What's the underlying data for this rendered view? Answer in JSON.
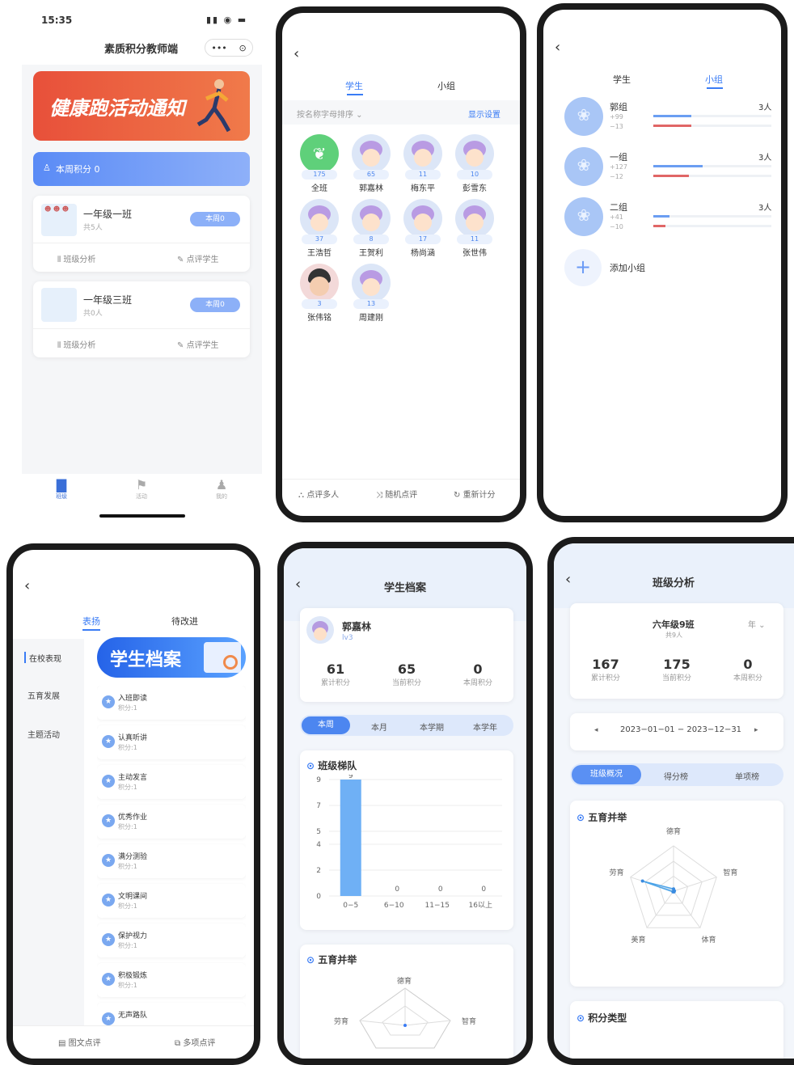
{
  "p1": {
    "time": "15:35",
    "title": "素质积分教师端",
    "banner": "健康跑活动通知",
    "weekly_score": "本周积分  0",
    "classes": [
      {
        "name": "一年级一班",
        "meta": "共5人",
        "badge": "本周0"
      },
      {
        "name": "一年级三班",
        "meta": "共0人",
        "badge": "本周0"
      }
    ],
    "analysis": "班级分析",
    "comment": "点评学生",
    "tabs": [
      "班级",
      "活动",
      "我的"
    ]
  },
  "p2": {
    "tabs": [
      "学生",
      "小组"
    ],
    "sort": "按名称字母排序",
    "settings": "显示设置",
    "students": [
      {
        "score": "175",
        "name": "全班"
      },
      {
        "score": "65",
        "name": "郭嘉林"
      },
      {
        "score": "11",
        "name": "梅东平"
      },
      {
        "score": "10",
        "name": "彭雪东"
      },
      {
        "score": "37",
        "name": "王浩哲"
      },
      {
        "score": "8",
        "name": "王贺利"
      },
      {
        "score": "17",
        "name": "杨尚涵"
      },
      {
        "score": "11",
        "name": "张世伟"
      },
      {
        "score": "3",
        "name": "张伟铭"
      },
      {
        "score": "13",
        "name": "周建刚"
      }
    ],
    "bottom": [
      "点评多人",
      "随机点评",
      "重新计分"
    ]
  },
  "p3": {
    "tabs": [
      "学生",
      "小组"
    ],
    "groups": [
      {
        "name": "郭组",
        "plus": "+99",
        "minus": "−13",
        "count": "3人",
        "plus_ratio": 0.32,
        "minus_ratio": 0.32
      },
      {
        "name": "一组",
        "plus": "+127",
        "minus": "−12",
        "count": "3人",
        "plus_ratio": 0.42,
        "minus_ratio": 0.3
      },
      {
        "name": "二组",
        "plus": "+41",
        "minus": "−10",
        "count": "3人",
        "plus_ratio": 0.14,
        "minus_ratio": 0.1
      }
    ],
    "add": "添加小组"
  },
  "p4": {
    "tabs": [
      "表扬",
      "待改进"
    ],
    "side": [
      "在校表现",
      "五育发展",
      "主题活动"
    ],
    "banner": "学生档案",
    "items": [
      {
        "name": "入班即读",
        "score": "积分:1"
      },
      {
        "name": "认真听讲",
        "score": "积分:1"
      },
      {
        "name": "主动发言",
        "score": "积分:1"
      },
      {
        "name": "优秀作业",
        "score": "积分:1"
      },
      {
        "name": "满分测验",
        "score": "积分:1"
      },
      {
        "name": "文明课间",
        "score": "积分:1"
      },
      {
        "name": "保护视力",
        "score": "积分:1"
      },
      {
        "name": "积极锻炼",
        "score": "积分:1"
      },
      {
        "name": "无声路队",
        "score": ""
      }
    ],
    "bottom": [
      "图文点评",
      "多项点评"
    ]
  },
  "p5": {
    "title": "学生档案",
    "name": "郭嘉林",
    "level": "lv3",
    "stats": [
      {
        "v": "61",
        "l": "累计积分"
      },
      {
        "v": "65",
        "l": "当前积分"
      },
      {
        "v": "0",
        "l": "本周积分"
      }
    ],
    "periods": [
      "本周",
      "本月",
      "本学期",
      "本学年"
    ],
    "section1": "班级梯队",
    "section2": "五育并举",
    "radar_labels": [
      "德育",
      "劳育",
      "智育"
    ]
  },
  "p6": {
    "title": "班级分析",
    "class": "六年级9班",
    "count": "共9人",
    "period": "年",
    "stats": [
      {
        "v": "167",
        "l": "累计积分"
      },
      {
        "v": "175",
        "l": "当前积分"
      },
      {
        "v": "0",
        "l": "本周积分"
      }
    ],
    "range": "2023−01−01 − 2023−12−31",
    "tabs": [
      "班级概况",
      "得分榜",
      "单项榜"
    ],
    "section1": "五育并举",
    "section2": "积分类型",
    "radar_labels": [
      "德育",
      "智育",
      "体育",
      "美育",
      "劳育"
    ]
  },
  "chart_data": [
    {
      "type": "bar",
      "title": "班级梯队",
      "categories": [
        "0−5",
        "6−10",
        "11−15",
        "16以上"
      ],
      "values": [
        9,
        0,
        0,
        0
      ],
      "yticks": [
        "0",
        "2",
        "4",
        "5",
        "7",
        "9"
      ],
      "ylim": [
        0,
        9
      ]
    },
    {
      "type": "radar",
      "title": "五育并举",
      "axes": [
        "德育",
        "智育",
        "体育",
        "美育",
        "劳育"
      ],
      "values": [
        0.05,
        0.02,
        0.02,
        0.02,
        0.72
      ]
    }
  ]
}
